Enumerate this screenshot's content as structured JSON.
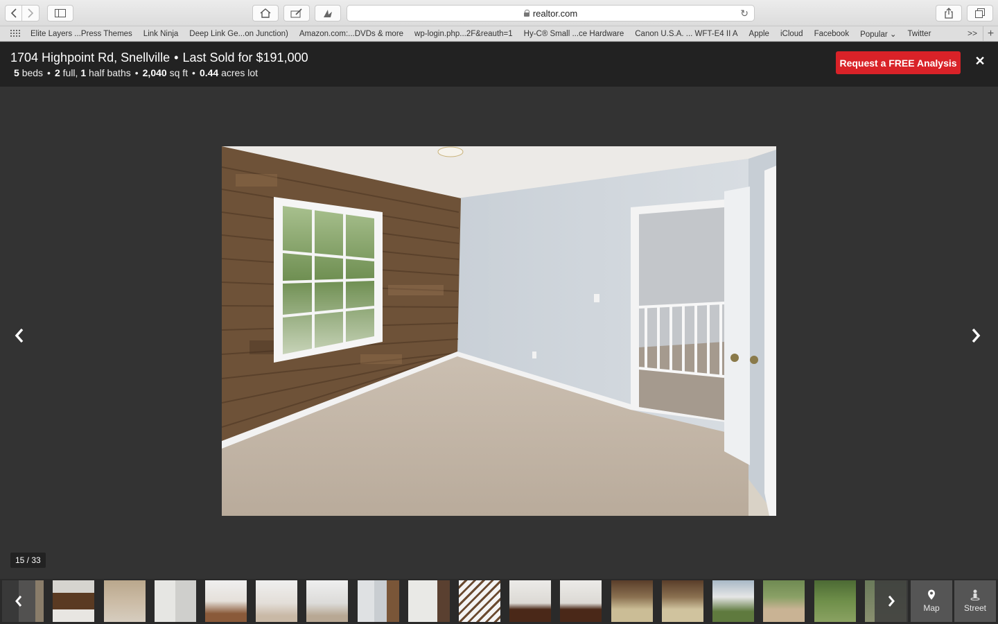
{
  "browser": {
    "url": "realtor.com",
    "bookmarks": [
      "Elite Layers ...Press Themes",
      "Link Ninja",
      "Deep Link Ge...on Junction)",
      "Amazon.com:...DVDs & more",
      "wp-login.php...2F&reauth=1",
      "Hy-C® Small ...ce Hardware",
      "Canon U.S.A. ... WFT-E4 II A",
      "Apple",
      "iCloud",
      "Facebook",
      "Popular ⌄",
      "Twitter"
    ],
    "bookmarks_more": ">>"
  },
  "listing": {
    "address": "1704 Highpoint Rd, Snellville",
    "sep": "•",
    "sold": "Last Sold for $191,000",
    "beds_num": "5",
    "beds_label": "beds",
    "full_num": "2",
    "full_label": "full,",
    "half_num": "1",
    "half_label": "half baths",
    "sqft_num": "2,040",
    "sqft_label": "sq ft",
    "lot_num": "0.44",
    "lot_label": "acres lot",
    "cta": "Request a FREE Analysis"
  },
  "viewer": {
    "counter": "15 / 33"
  },
  "filmstrip": {
    "map_label": "Map",
    "street_label": "Street"
  }
}
